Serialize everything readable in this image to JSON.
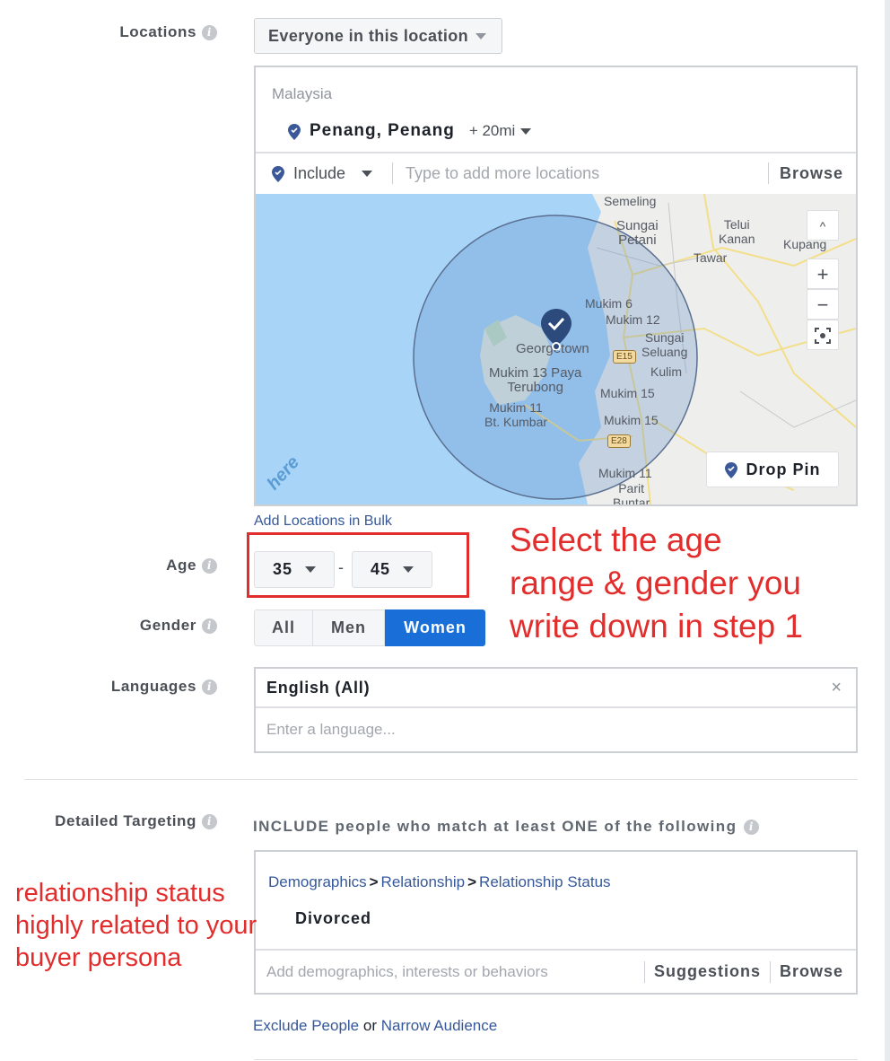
{
  "locations": {
    "label": "Locations",
    "scope_dropdown": "Everyone in this location",
    "country": "Malaysia",
    "selected": {
      "name": "Penang, Penang",
      "radius": "+ 20mi"
    },
    "include_mode": "Include",
    "search_placeholder": "Type to add more locations",
    "browse_label": "Browse",
    "map": {
      "labels": [
        "Semeling",
        "Sungai Petani",
        "Telui Kanan",
        "Kupang",
        "Tawar",
        "Mukim 6",
        "Mukim 12",
        "Sungai Seluang",
        "Georgetown",
        "Mukim 13 Paya Terubong",
        "Kulim",
        "Mukim 15",
        "Mukim 11 Bt. Kumbar",
        "Mukim 15",
        "Mukim 11",
        "Parit Buntar"
      ],
      "road_shields": [
        "E15",
        "E28"
      ],
      "attribution": "here",
      "controls": {
        "collapse": "^",
        "zoom_in": "+",
        "zoom_out": "−"
      },
      "drop_pin_label": "Drop Pin"
    },
    "bulk_link": "Add Locations in Bulk"
  },
  "age": {
    "label": "Age",
    "min": "35",
    "separator": "-",
    "max": "45"
  },
  "gender": {
    "label": "Gender",
    "options": [
      "All",
      "Men",
      "Women"
    ],
    "selected": "Women"
  },
  "languages": {
    "label": "Languages",
    "selected": "English (All)",
    "remove": "×",
    "placeholder": "Enter a language..."
  },
  "detailed_targeting": {
    "label": "Detailed Targeting",
    "heading": "INCLUDE people who match at least ONE of the following",
    "breadcrumb": [
      "Demographics",
      "Relationship",
      "Relationship Status"
    ],
    "breadcrumb_separator": ">",
    "item": "Divorced",
    "placeholder": "Add demographics, interests or behaviors",
    "suggestions_label": "Suggestions",
    "browse_label": "Browse",
    "exclude_link": "Exclude People",
    "or_text": "or",
    "narrow_link": "Narrow Audience"
  },
  "annotations": {
    "age_gender": [
      "Select the age",
      "range & gender you",
      "write down in step 1"
    ],
    "relationship": [
      "relationship status",
      "highly related to your",
      "buyer persona"
    ],
    "color": "#e22d2d"
  },
  "colors": {
    "accent": "#1a6ed8",
    "link": "#365899",
    "pin": "#3b5998"
  }
}
